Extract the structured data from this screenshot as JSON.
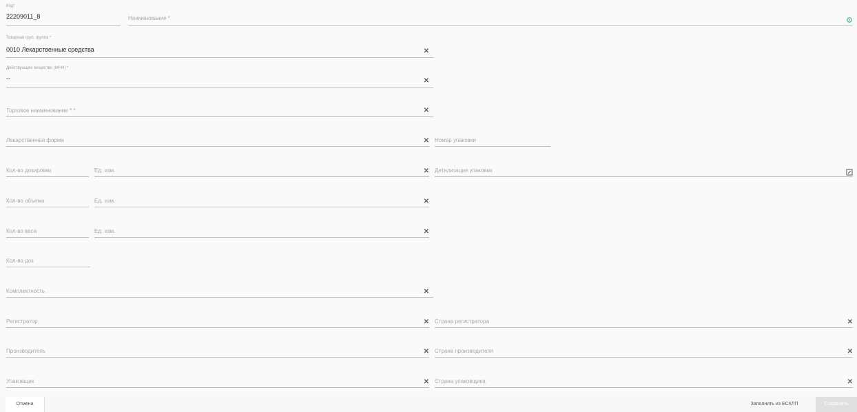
{
  "fields": {
    "code": {
      "label": "Код*",
      "value": "22209011_8"
    },
    "name": {
      "placeholder": "Наименование *"
    },
    "group": {
      "label": "Товарная груп. группа *",
      "value": "0010 Лекарственные средства"
    },
    "substance": {
      "label": "Действующее вещество (МНН) *",
      "value": "--"
    },
    "trade_name": {
      "placeholder": "Торговое наименование * *"
    },
    "dosage_form": {
      "placeholder": "Лекарственная форма"
    },
    "package_number": {
      "placeholder": "Номер упаковки"
    },
    "dosage_qty": {
      "placeholder": "Кол-во дозировки"
    },
    "dosage_unit": {
      "placeholder": "Ед. изм."
    },
    "package_detail": {
      "placeholder": "Детализация упаковки"
    },
    "volume_qty": {
      "placeholder": "Кол-во объема"
    },
    "volume_unit": {
      "placeholder": "Ед. изм."
    },
    "weight_qty": {
      "placeholder": "Кол-во веса"
    },
    "weight_unit": {
      "placeholder": "Ед. изм."
    },
    "doses_qty": {
      "placeholder": "Кол-во доз"
    },
    "completeness": {
      "placeholder": "Комплектность"
    },
    "registrar": {
      "placeholder": "Регистратор"
    },
    "registrar_country": {
      "placeholder": "Страна регистратора"
    },
    "manufacturer": {
      "placeholder": "Производитель"
    },
    "manufacturer_country": {
      "placeholder": "Страна производителя"
    },
    "packager": {
      "placeholder": "Упаковщик"
    },
    "packager_country": {
      "placeholder": "Страна упаковщика"
    }
  },
  "icons": {
    "clear": "✕",
    "settings": "gear-icon",
    "edit": "edit-icon"
  },
  "footer": {
    "cancel": "Отмена",
    "fill_from_esklp": "Заполнить из ЕСКЛП",
    "save": "Сохранить"
  },
  "colors": {
    "accent": "#4db6ac",
    "disabled_button": "#e0e0e0"
  }
}
